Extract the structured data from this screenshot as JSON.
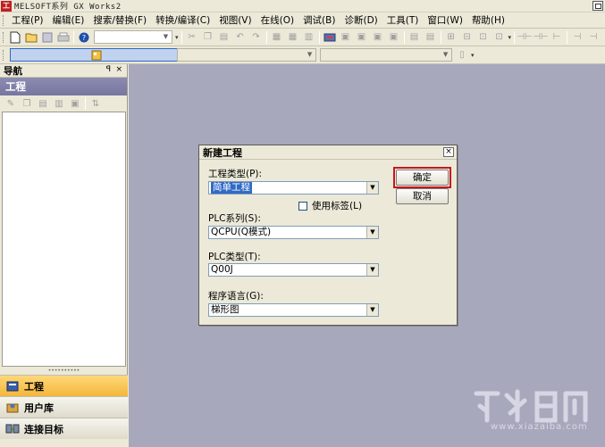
{
  "window": {
    "title": "MELSOFT系列 GX Works2",
    "app_icon": "melsoft-logo"
  },
  "menu": [
    "工程(P)",
    "编辑(E)",
    "搜索/替换(F)",
    "转换/编译(C)",
    "视图(V)",
    "在线(O)",
    "调试(B)",
    "诊断(D)",
    "工具(T)",
    "窗口(W)",
    "帮助(H)"
  ],
  "navigation": {
    "header": "导航",
    "pin_glyph": "ꟼ",
    "close_glyph": "×",
    "section_title": "工程",
    "tabs": [
      {
        "label": "工程",
        "icon": "project-icon",
        "active": true
      },
      {
        "label": "用户库",
        "icon": "user-library-icon",
        "active": false
      },
      {
        "label": "连接目标",
        "icon": "connection-target-icon",
        "active": false
      }
    ]
  },
  "dialog": {
    "title": "新建工程",
    "close_glyph": "×",
    "project_type_label": "工程类型(P):",
    "project_type_value": "简单工程",
    "use_label_text": "使用标签(L)",
    "use_label_checked": false,
    "plc_series_label": "PLC系列(S):",
    "plc_series_value": "QCPU(Q模式)",
    "plc_type_label": "PLC类型(T):",
    "plc_type_value": "Q00J",
    "program_language_label": "程序语言(G):",
    "program_language_value": "梯形图",
    "ok_label": "确定",
    "cancel_label": "取消"
  },
  "watermark": {
    "text": "www.xiazaiba.com"
  },
  "colors": {
    "workspace": "#a8a8bc",
    "highlight_frame": "#c8161e",
    "selection": "#316ac5"
  }
}
